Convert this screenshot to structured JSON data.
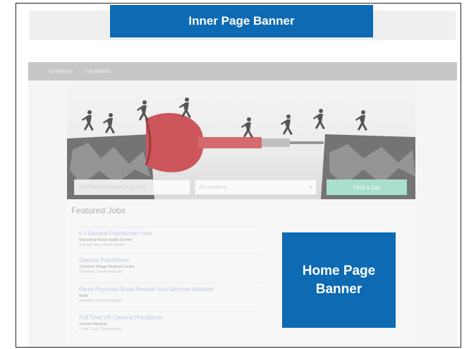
{
  "callouts": {
    "inner_page_banner": "Inner Page Banner",
    "home_page_banner": "Home Page Banner"
  },
  "colors": {
    "callout_blue": "#0d6ab3",
    "find_button": "#9fdcc9",
    "job_title_link": "#b5c3de"
  },
  "site": {
    "nav_items": [
      "Employers",
      "Candidates"
    ],
    "hero_icons": [
      "running-figure",
      "dart-icon",
      "cliff-gap"
    ],
    "search": {
      "keyword_placeholder": "Job Title or Keyword (e.g. GP)",
      "location_value": "All Locations",
      "find_button": "Find a Job"
    },
    "featured_title": "Featured Jobs",
    "jobs": [
      {
        "title": "5 x General Practitioner roles",
        "org": "Macarthur Rural Health Centre",
        "loc": "Dorrigo, New South Wales"
      },
      {
        "title": "General Practitioner",
        "org": "Thornton Village Medical Centre",
        "loc": "Thornton, South Australia"
      },
      {
        "title": "Panel Physician Bupa Medical Visa Services Adelaide",
        "org": "Bupa",
        "loc": "Adelaide, South Australia"
      },
      {
        "title": "Full Time VR General Practitioner",
        "org": "Sunrise Medical",
        "loc": "Coral Cove, Queensland"
      }
    ]
  }
}
